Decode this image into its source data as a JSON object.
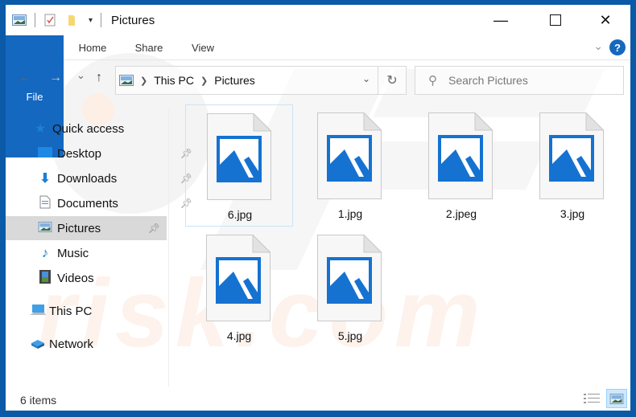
{
  "window": {
    "title": "Pictures",
    "minimize_icon": "minimize-icon",
    "maximize_icon": "maximize-icon",
    "close_icon": "close-icon",
    "frame_color": "#0b5aa8"
  },
  "quick_access_toolbar": [
    "pictures-folder-icon",
    "properties-icon",
    "new-folder-icon",
    "customize-dropdown-icon"
  ],
  "ribbon": {
    "tabs": [
      {
        "label": "File",
        "active": true
      },
      {
        "label": "Home"
      },
      {
        "label": "Share"
      },
      {
        "label": "View"
      }
    ],
    "help_label": "?",
    "accent": "#1468bf"
  },
  "navigation": {
    "back_icon": "←",
    "forward_icon": "→",
    "recent_icon": "⌄",
    "up_icon": "↑",
    "breadcrumb": [
      "This PC",
      "Pictures"
    ],
    "refresh_icon": "↻",
    "search_placeholder": "Search Pictures"
  },
  "sidebar": {
    "items": [
      {
        "label": "Quick access",
        "icon": "star-icon",
        "level": 0
      },
      {
        "label": "Desktop",
        "icon": "desktop-icon",
        "level": 1,
        "pinned": true
      },
      {
        "label": "Downloads",
        "icon": "download-icon",
        "level": 1,
        "pinned": true
      },
      {
        "label": "Documents",
        "icon": "documents-icon",
        "level": 1,
        "pinned": true
      },
      {
        "label": "Pictures",
        "icon": "pictures-icon",
        "level": 1,
        "pinned": true,
        "selected": true
      },
      {
        "label": "Music",
        "icon": "music-icon",
        "level": 1
      },
      {
        "label": "Videos",
        "icon": "videos-icon",
        "level": 1
      },
      {
        "label": "This PC",
        "icon": "computer-icon",
        "level": 0
      },
      {
        "label": "Network",
        "icon": "network-icon",
        "level": 0
      }
    ]
  },
  "files": [
    {
      "name": "6.jpg",
      "selected": true
    },
    {
      "name": "1.jpg"
    },
    {
      "name": "2.jpeg"
    },
    {
      "name": "3.jpg"
    },
    {
      "name": "4.jpg"
    },
    {
      "name": "5.jpg"
    }
  ],
  "status": {
    "item_count": "6 items"
  },
  "watermark": "risk.com"
}
